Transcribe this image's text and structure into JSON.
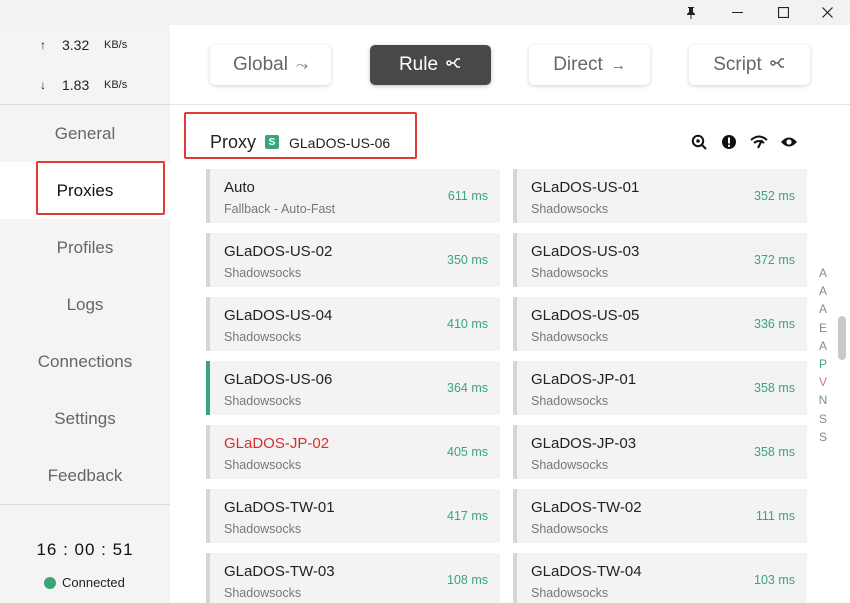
{
  "window": {
    "pin_icon": "pin-icon",
    "minimize_icon": "minimize-icon",
    "maximize_icon": "maximize-icon",
    "close_icon": "close-icon"
  },
  "traffic": {
    "upload_arrow": "↑",
    "upload_value": "3.32",
    "upload_unit": "KB/s",
    "download_arrow": "↓",
    "download_value": "1.83",
    "download_unit": "KB/s"
  },
  "nav": {
    "items": [
      {
        "label": "General"
      },
      {
        "label": "Proxies"
      },
      {
        "label": "Profiles"
      },
      {
        "label": "Logs"
      },
      {
        "label": "Connections"
      },
      {
        "label": "Settings"
      },
      {
        "label": "Feedback"
      }
    ],
    "active": "Proxies"
  },
  "status": {
    "clock": "16 : 00 : 51",
    "connection": "Connected",
    "connection_color": "#3aa676"
  },
  "modes": [
    {
      "label": "Global",
      "icon": "⤳"
    },
    {
      "label": "Rule",
      "icon": "⊰"
    },
    {
      "label": "Direct",
      "icon": "→"
    },
    {
      "label": "Script",
      "icon": "⊰"
    }
  ],
  "active_mode": "Rule",
  "group": {
    "title": "Proxy",
    "badge": "S",
    "selected_proxy": "GLaDOS-US-06",
    "icons": [
      "search-latency-icon",
      "alert-icon",
      "wifi-speed-icon",
      "eye-icon"
    ]
  },
  "proxies": [
    {
      "name": "Auto",
      "type": "Fallback - Auto-Fast",
      "delay": "611 ms"
    },
    {
      "name": "GLaDOS-US-01",
      "type": "Shadowsocks",
      "delay": "352 ms"
    },
    {
      "name": "GLaDOS-US-02",
      "type": "Shadowsocks",
      "delay": "350 ms"
    },
    {
      "name": "GLaDOS-US-03",
      "type": "Shadowsocks",
      "delay": "372 ms"
    },
    {
      "name": "GLaDOS-US-04",
      "type": "Shadowsocks",
      "delay": "410 ms"
    },
    {
      "name": "GLaDOS-US-05",
      "type": "Shadowsocks",
      "delay": "336 ms"
    },
    {
      "name": "GLaDOS-US-06",
      "type": "Shadowsocks",
      "delay": "364 ms"
    },
    {
      "name": "GLaDOS-JP-01",
      "type": "Shadowsocks",
      "delay": "358 ms"
    },
    {
      "name": "GLaDOS-JP-02",
      "type": "Shadowsocks",
      "delay": "405 ms"
    },
    {
      "name": "GLaDOS-JP-03",
      "type": "Shadowsocks",
      "delay": "358 ms"
    },
    {
      "name": "GLaDOS-TW-01",
      "type": "Shadowsocks",
      "delay": "417 ms"
    },
    {
      "name": "GLaDOS-TW-02",
      "type": "Shadowsocks",
      "delay": "111 ms"
    },
    {
      "name": "GLaDOS-TW-03",
      "type": "Shadowsocks",
      "delay": "108 ms"
    },
    {
      "name": "GLaDOS-TW-04",
      "type": "Shadowsocks",
      "delay": "103 ms"
    }
  ],
  "index_letters": [
    "A",
    "A",
    "A",
    "E",
    "A",
    "P",
    "V",
    "N",
    "S",
    "S"
  ],
  "colors": {
    "accent": "#3aa676",
    "highlight_box": "#e53935",
    "error_text": "#d32f2f"
  }
}
